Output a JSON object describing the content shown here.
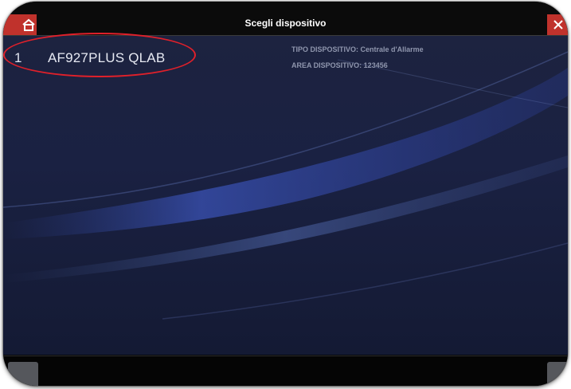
{
  "header": {
    "title": "Scegli dispositivo",
    "home_icon": "home-icon",
    "close_icon": "close-icon"
  },
  "devices": [
    {
      "index": "1",
      "name": "AF927PLUS QLAB",
      "type_line": "TIPO DISPOSITIVO: Centrale d'Allarme",
      "area_line": "AREA DISPOSITIVO: 123456"
    }
  ],
  "colors": {
    "accent_red": "#c0322c",
    "highlight_red": "#e0202a",
    "background_blue": "#1a2142"
  }
}
